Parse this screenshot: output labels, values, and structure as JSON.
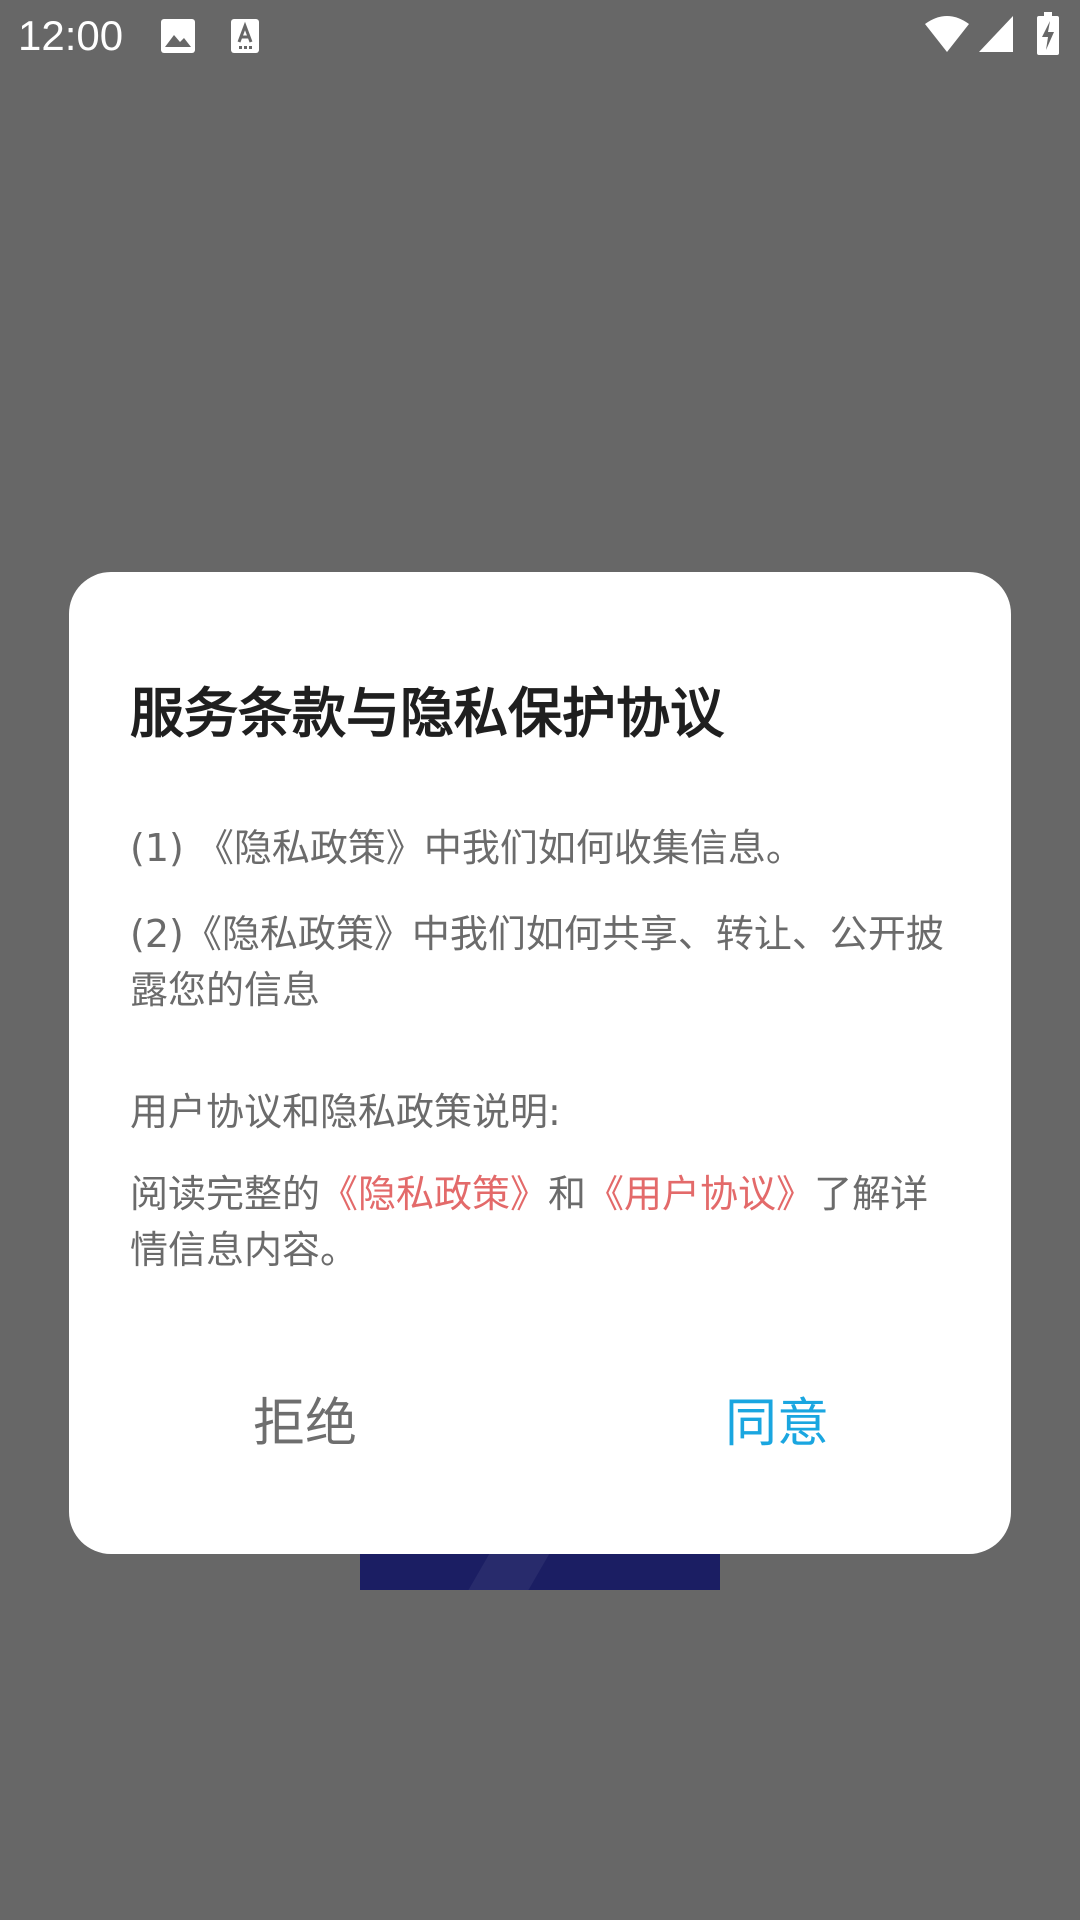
{
  "status_bar": {
    "time": "12:00",
    "icons": [
      "image-icon",
      "text-input-icon",
      "wifi-icon",
      "signal-icon",
      "battery-charging-icon"
    ]
  },
  "dialog": {
    "title": "服务条款与隐私保护协议",
    "item_1": "(1) 《隐私政策》中我们如何收集信息。",
    "item_2": "(2)《隐私政策》中我们如何共享、转让、公开披露您的信息",
    "section_heading": "用户协议和隐私政策说明:",
    "read_prefix": "阅读完整的",
    "privacy_link": "《隐私政策》",
    "and_text": "和",
    "user_agreement_link": "《用户协议》",
    "read_suffix": "了解详情信息内容。",
    "reject_label": "拒绝",
    "agree_label": "同意"
  },
  "colors": {
    "overlay": "#676767",
    "link": "#e36a6a",
    "agree": "#1aa6e0",
    "reject": "#6e6e6e",
    "title": "#1f1f1f"
  }
}
